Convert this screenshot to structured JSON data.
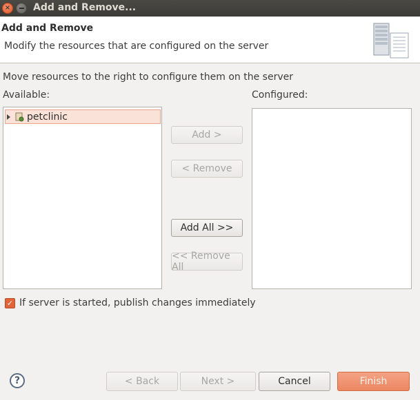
{
  "window": {
    "title": "Add and Remove..."
  },
  "header": {
    "title": "Add and Remove",
    "description": "Modify the resources that are configured on the server",
    "icon": "server-icon"
  },
  "instruction": "Move resources to the right to configure them on the server",
  "available": {
    "label": "Available:",
    "items": [
      {
        "label": "petclinic",
        "icon": "project-icon",
        "selected": true
      }
    ]
  },
  "configured": {
    "label": "Configured:",
    "items": []
  },
  "buttons": {
    "add": "Add >",
    "remove": "< Remove",
    "add_all": "Add All >>",
    "remove_all": "<< Remove All"
  },
  "publish_option": {
    "label": "If server is started, publish changes immediately",
    "checked": true
  },
  "footer": {
    "help": "?",
    "back": "< Back",
    "next": "Next >",
    "cancel": "Cancel",
    "finish": "Finish"
  },
  "colors": {
    "accent": "#e0663a",
    "selection": "#fbe2d8"
  }
}
